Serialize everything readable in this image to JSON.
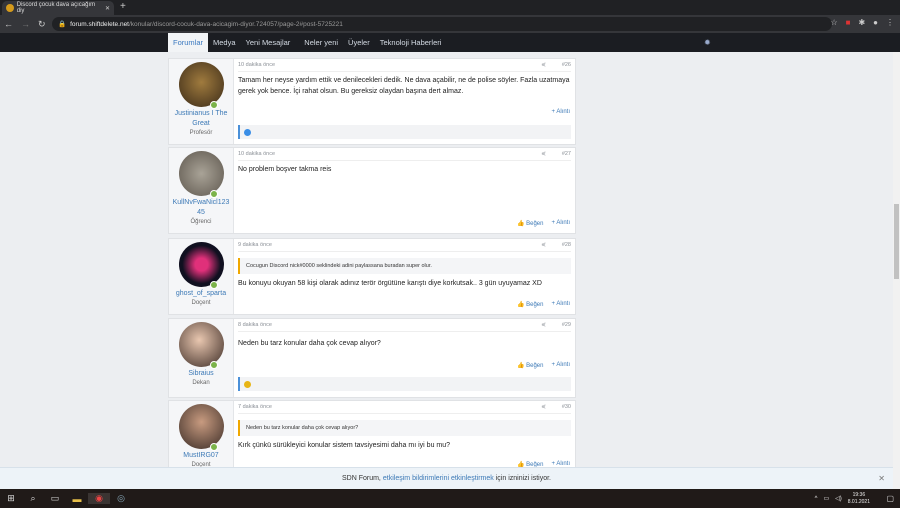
{
  "browser": {
    "tab_title": "Discord çocuk dava açıcağım diy",
    "url_host": "forum.shiftdelete.net",
    "url_path": "/konular/discord-cocuk-dava-acicagim-diyor.724057/page-2#post-5725221"
  },
  "nav": {
    "items": [
      "Forumlar",
      "Medya",
      "Yeni Mesajlar",
      "Neler yeni",
      "Üyeler",
      "Teknoloji Haberleri"
    ]
  },
  "actions": {
    "like": "Beğen",
    "quote": "+ Alıntı"
  },
  "posts": [
    {
      "user": "Justinianus I The Great",
      "title": "Profesör",
      "time": "10 dakika önce",
      "num": "#26",
      "text": "Tamam her neyse yardım ettik ve denilecekleri dedik. Ne dava açabilir, ne de polise söyler. Fazla uzatmaya gerek yok bence. İçi rahat olsun. Bu gereksiz olaydan başına dert almaz."
    },
    {
      "user": "KullNvFwaNicl12345",
      "title": "Öğrenci",
      "time": "10 dakika önce",
      "num": "#27",
      "text": "No problem boşver takma reis"
    },
    {
      "user": "ghost_of_sparta",
      "title": "Doçent",
      "time": "9 dakika önce",
      "num": "#28",
      "quote": "Cocugun Discord nick#0000 seklindeki adini paylassana buradan super olur.",
      "text": "Bu konuyu okuyan 58 kişi olarak adınız terör örgütüne karıştı diye korkutsak.. 3 gün uyuyamaz XD"
    },
    {
      "user": "Sibraius",
      "title": "Dekan",
      "time": "8 dakika önce",
      "num": "#29",
      "text": "Neden bu tarz konular daha çok cevap alıyor?"
    },
    {
      "user": "MustIRG07",
      "title": "Doçent",
      "time": "7 dakika önce",
      "num": "#30",
      "quote": "Neden bu tarz konular daha çok cevap alıyor?",
      "text": "Kırk çünkü sürükleyici konular sistem tavsiyesimi daha mı iyi bu mu?"
    }
  ],
  "notice": {
    "pre": "SDN Forum,",
    "link": "etkileşim bildirimlerini etkinleştirmek",
    "post": "için izninizi istiyor."
  },
  "clock": {
    "time": "19:36",
    "date": "8.01.2021"
  }
}
